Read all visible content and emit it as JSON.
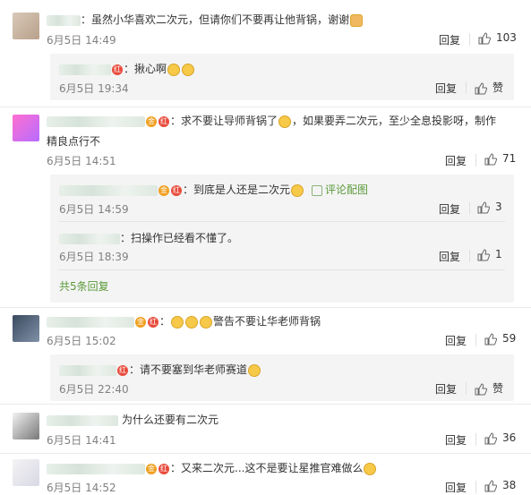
{
  "colors": {
    "badge_red": "#e84c3d",
    "link_green": "#5a9a3a",
    "meta_gray": "#808080",
    "subbox_bg": "#f4f4f4"
  },
  "c1": {
    "text": "：虽然小华喜欢二次元，但请你们不要再让他背锅，谢谢",
    "date": "6月5日 14:49",
    "reply": "回复",
    "likes": "103"
  },
  "c1r1": {
    "text": "：揪心啊",
    "date": "6月5日 19:34",
    "reply": "回复",
    "likes": "赞"
  },
  "c2": {
    "text": "：求不要让导师背锅了",
    "text2": "，如果要弄二次元，至少全息投影呀，制作",
    "text3": "精良点行不",
    "date": "6月5日 14:51",
    "reply": "回复",
    "likes": "71"
  },
  "c2r1": {
    "text": "：到底是人还是二次元",
    "link": "评论配图",
    "date": "6月5日 14:59",
    "reply": "回复",
    "likes": "3"
  },
  "c2r2": {
    "text": "：扫操作已经看不懂了。",
    "date": "6月5日 18:39",
    "reply": "回复",
    "likes": "1"
  },
  "c2more": {
    "text": "共5条回复"
  },
  "c3": {
    "text": "警告不要让华老师背锅",
    "date": "6月5日 15:02",
    "reply": "回复",
    "likes": "59"
  },
  "c3r1": {
    "text": "：请不要塞到华老师赛道",
    "date": "6月5日 22:40",
    "reply": "回复",
    "likes": "赞"
  },
  "c4": {
    "text": "为什么还要有二次元",
    "date": "6月5日 14:41",
    "reply": "回复",
    "likes": "36"
  },
  "c5": {
    "text": "：又来二次元...这不是要让星推官难做么",
    "date": "6月5日 14:52",
    "reply": "回复",
    "likes": "38"
  },
  "badges": {
    "red": "红",
    "gold": "金"
  }
}
